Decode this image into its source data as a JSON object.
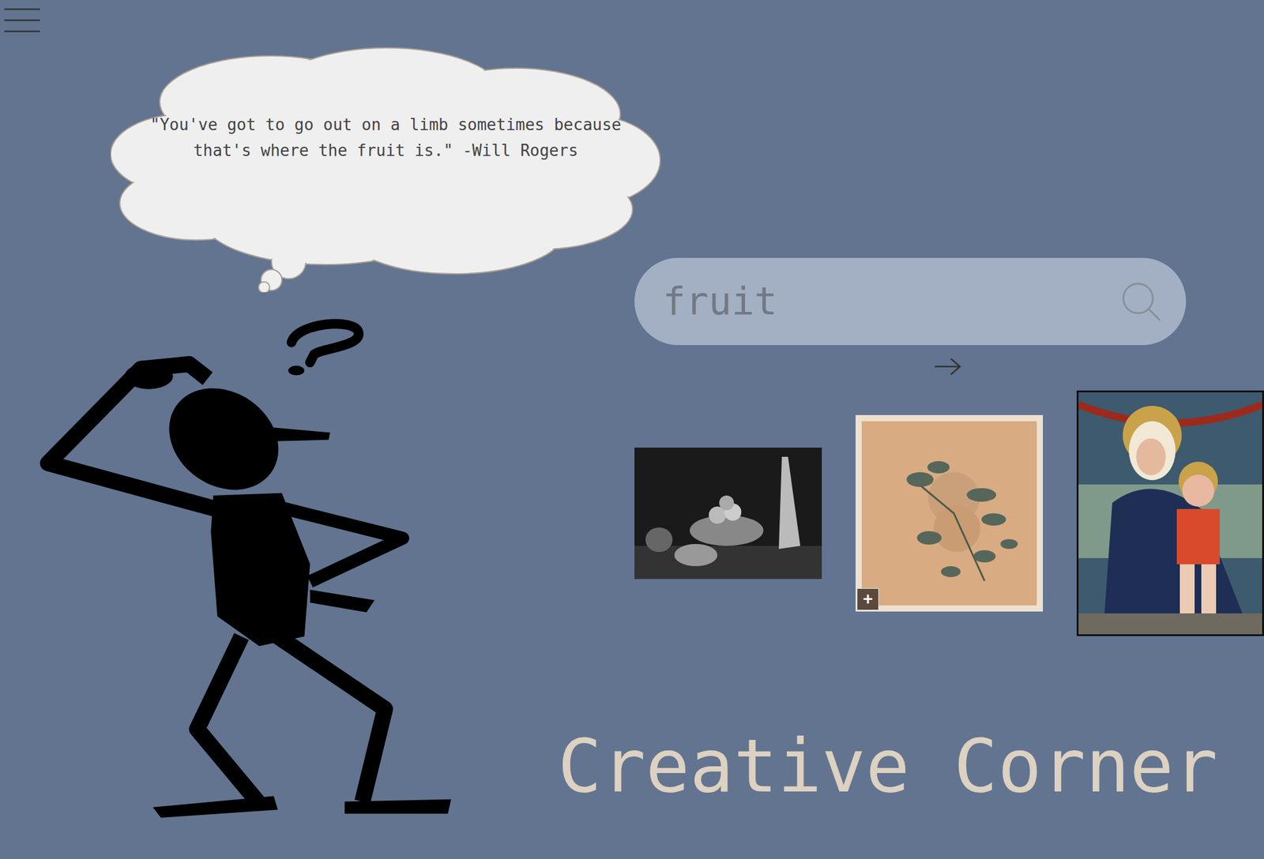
{
  "quote": {
    "text": "\"You've got to go out on a limb sometimes because that's where the fruit is.\" -Will Rogers"
  },
  "search": {
    "value": "fruit"
  },
  "results": [
    {
      "kind": "plain"
    },
    {
      "kind": "badged",
      "badge": "+"
    },
    {
      "kind": "plain"
    }
  ],
  "page": {
    "title": "Creative Corner"
  }
}
